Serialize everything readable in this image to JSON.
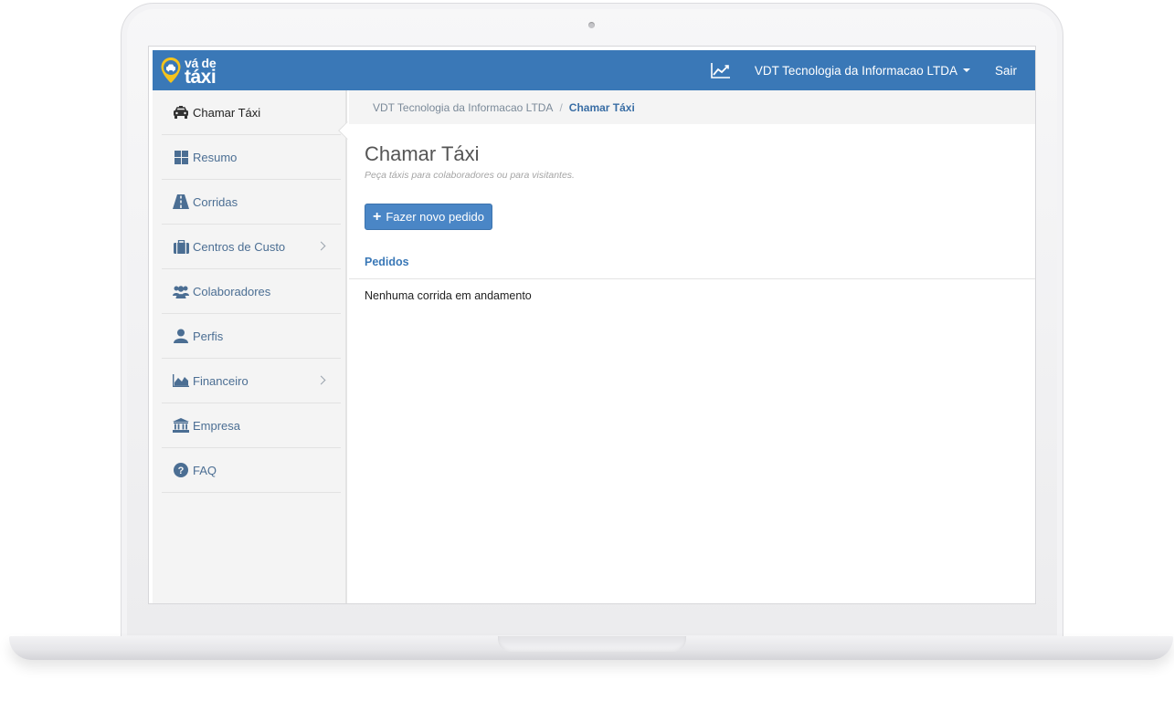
{
  "navbar": {
    "logo_line1": "vá de",
    "logo_line2": "táxi",
    "chart_icon": "line-chart-icon",
    "company_name": "VDT Tecnologia da Informacao LTDA",
    "logout_label": "Sair"
  },
  "sidebar": {
    "items": [
      {
        "label": "Chamar Táxi",
        "icon": "taxi-icon"
      },
      {
        "label": "Resumo",
        "icon": "dashboard-icon"
      },
      {
        "label": "Corridas",
        "icon": "road-icon"
      },
      {
        "label": "Centros de Custo",
        "icon": "briefcase-icon"
      },
      {
        "label": "Colaboradores",
        "icon": "users-icon"
      },
      {
        "label": "Perfis",
        "icon": "user-icon"
      },
      {
        "label": "Financeiro",
        "icon": "area-chart-icon"
      },
      {
        "label": "Empresa",
        "icon": "bank-icon"
      },
      {
        "label": "FAQ",
        "icon": "question-circle-icon"
      }
    ]
  },
  "breadcrumb": {
    "items": [
      "VDT Tecnologia da Informacao LTDA",
      "Chamar Táxi"
    ],
    "separator": "/"
  },
  "main": {
    "title": "Chamar Táxi",
    "subtitle": "Peça táxis para colaboradores ou para visitantes.",
    "new_order_button": "Fazer novo pedido",
    "orders_heading": "Pedidos",
    "empty_message": "Nenhuma corrida em andamento"
  },
  "colors": {
    "navbar": "#3a78b7",
    "button": "#4a86c6",
    "link": "#4b6e93",
    "sidebar_bg": "#f4f4f4"
  }
}
